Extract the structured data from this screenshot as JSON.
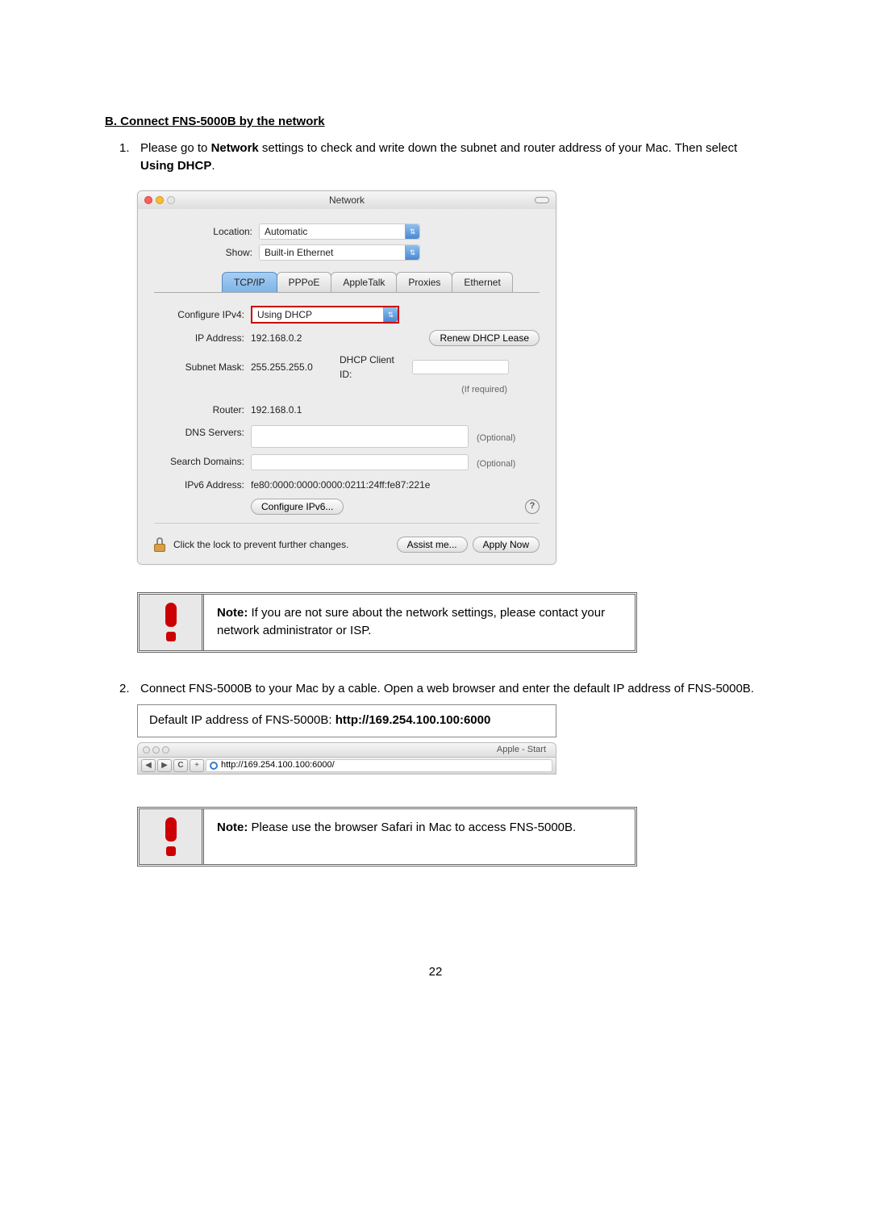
{
  "heading": "B.  Connect FNS-5000B by the network",
  "step1_num": "1.",
  "step1_pre": "Please go to ",
  "step1_b1": "Network",
  "step1_mid": " settings to check and write down the subnet and router address of your Mac.  Then select ",
  "step1_b2": "Using DHCP",
  "step1_post": ".",
  "win": {
    "title": "Network",
    "location_lbl": "Location:",
    "location_val": "Automatic",
    "show_lbl": "Show:",
    "show_val": "Built-in Ethernet",
    "tabs": [
      "TCP/IP",
      "PPPoE",
      "AppleTalk",
      "Proxies",
      "Ethernet"
    ],
    "cfg_lbl": "Configure IPv4:",
    "cfg_val": "Using DHCP",
    "ip_lbl": "IP Address:",
    "ip_val": "192.168.0.2",
    "renew": "Renew DHCP Lease",
    "subnet_lbl": "Subnet Mask:",
    "subnet_val": "255.255.255.0",
    "dhcpid_lbl": "DHCP Client ID:",
    "dhcpid_note": "(If required)",
    "router_lbl": "Router:",
    "router_val": "192.168.0.1",
    "dns_lbl": "DNS Servers:",
    "optional": "(Optional)",
    "search_lbl": "Search Domains:",
    "ipv6_lbl": "IPv6 Address:",
    "ipv6_val": "fe80:0000:0000:0000:0211:24ff:fe87:221e",
    "cfg6_btn": "Configure IPv6...",
    "lock_text": "Click the lock to prevent further changes.",
    "assist": "Assist me...",
    "apply": "Apply Now",
    "help": "?"
  },
  "note1_b": "Note:",
  "note1": " If you are not sure about the network settings, please contact your network administrator or ISP.",
  "step2_num": "2.",
  "step2": "Connect FNS-5000B to your Mac by a cable.  Open a web browser and enter the default IP address of FNS-5000B.",
  "ipbox_pre": "Default IP address of FNS-5000B: ",
  "ipbox_b": "http://169.254.100.100:6000",
  "browser": {
    "title": "Apple - Start",
    "url": "http://169.254.100.100:6000/",
    "back": "◀",
    "fwd": "▶",
    "reload": "C",
    "add": "+"
  },
  "note2_b": "Note:",
  "note2": " Please use the browser Safari in Mac to access FNS-5000B.",
  "pagenum": "22"
}
